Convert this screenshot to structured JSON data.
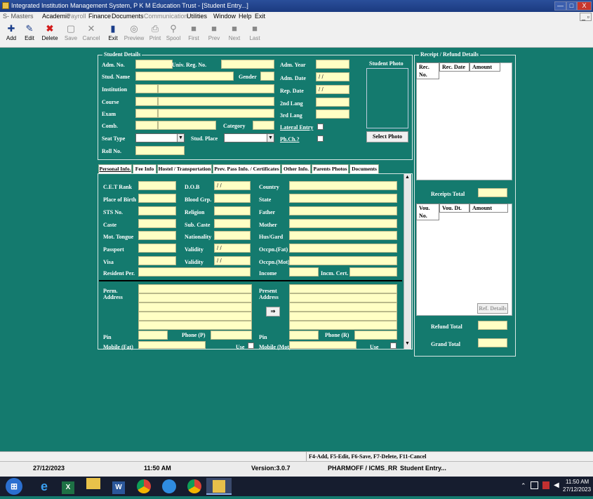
{
  "window": {
    "title": "Integrated Institution Management System, P K M Education Trust - [Student Entry...]",
    "controls": {
      "minimize": "—",
      "maximize": "□",
      "close": "X",
      "mdi_restore": "_ ▫"
    }
  },
  "menu": [
    "S- Masters",
    "Academic",
    "Payroll",
    "Finance",
    "Documents",
    "Communication",
    "Utilities",
    "Window",
    "Help",
    "Exit"
  ],
  "toolbar": {
    "add": "Add",
    "edit": "Edit",
    "delete": "Delete",
    "save": "Save",
    "cancel": "Cancel",
    "exit": "Exit",
    "preview": "Preview",
    "print": "Print",
    "spool": "Spool",
    "first": "First",
    "prev": "Prev",
    "next": "Next",
    "last": "Last"
  },
  "student_details": {
    "group_title": "Student Details",
    "adm_no": "Adm. No.",
    "univ_reg_no": "Univ. Reg. No.",
    "stud_name": "Stud. Name",
    "gender": "Gender",
    "institution": "Institution",
    "course": "Course",
    "exam": "Exam",
    "comb": "Comb.",
    "category": "Category",
    "seat_type": "Seat Type",
    "stud_place": "Stud. Place",
    "roll_no": "Roll No.",
    "adm_year": "Adm. Year",
    "adm_date": "Adm. Date",
    "rep_date": "Rep. Date",
    "lang2": "2nd Lang",
    "lang3": "3rd Lang",
    "lateral_entry": "Lateral Entry",
    "ph_ch": "Ph.Ch.?",
    "student_photo": "Student Photo",
    "select_photo": "Select Photo",
    "date_blank": "/ /"
  },
  "tabs": [
    "Personal Info.",
    "Fee Info",
    "Hostel / Transportation",
    "Prev. Pass Info. / Certificates",
    "Other Info.",
    "Parents Photos",
    "Documents"
  ],
  "personal": {
    "cet_rank": "C.E.T Rank",
    "dob": "D.O.B",
    "country": "Country",
    "place_of_birth": "Place of Birth",
    "blood_grp": "Blood Grp.",
    "state": "State",
    "sts_no": "STS No.",
    "religion": "Religion",
    "father": "Father",
    "caste": "Caste",
    "sub_caste": "Sub. Caste",
    "mother": "Mother",
    "mot_tongue": "Mot. Tongue",
    "nationality": "Nationality",
    "hus_gard": "Hus/Gard",
    "passport": "Passport",
    "validity": "Validity",
    "occpn_fat": "Occpn.(Fat)",
    "visa": "Visa",
    "occpn_mot": "Occpn.(Mot)",
    "resident_per": "Resident Per.",
    "income": "Income",
    "incm_cert": "Incm. Cert.",
    "perm_address": "Perm.",
    "perm_address2": "Address",
    "present_address": "Present",
    "present_address2": "Address",
    "copy_arrow": "⇒",
    "pin": "Pin",
    "phone_p": "Phone (P)",
    "phone_r": "Phone (R)",
    "mobile_fat": "Mobile (Fat)",
    "mobile_mot": "Mobile (Mot)",
    "use": "Use"
  },
  "receipt": {
    "group_title": "Receipt / Refund Details",
    "cols": [
      "Rec. No.",
      "Rec. Date",
      "Amount"
    ],
    "receipts_total": "Receipts Total",
    "vou_cols": [
      "Vou. No.",
      "Vou. Dt.",
      "Amount"
    ],
    "ref_details": "Ref. Details",
    "refund_total": "Refund Total",
    "grand_total": "Grand Total"
  },
  "status": {
    "shortcuts": "F4-Add, F5-Edit, F6-Save, F7-Delete, F11-Cancel",
    "date": "27/12/2023",
    "time": "11:50 AM",
    "version": "Version:3.0.7",
    "user": "PHARMOFF / ICMS_RR",
    "form": "Student Entry..."
  },
  "taskbar": {
    "clock_time": "11:50 AM",
    "clock_date": "27/12/2023",
    "tray_up": "⌃"
  }
}
